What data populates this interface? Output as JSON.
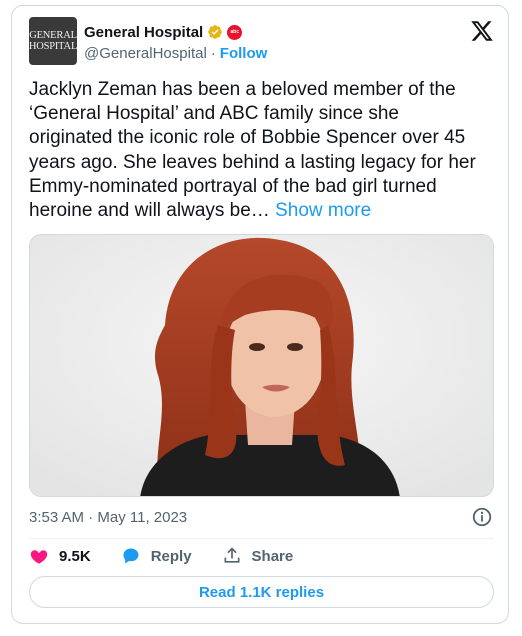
{
  "account": {
    "avatar_text_line1": "General",
    "avatar_text_line2": "Hospital",
    "display_name": "General Hospital",
    "handle": "@GeneralHospital",
    "separator": "·",
    "follow_label": "Follow",
    "verified_icon": "gold-verified-badge-icon",
    "affiliate_logo": "abc-logo"
  },
  "tweet": {
    "text": "Jacklyn Zeman has been a beloved member of the\n‘General Hospital’ and ABC family since she\noriginated the iconic role of Bobbie Spencer over 45\nyears ago. She leaves behind a lasting legacy for her\nEmmy-nominated portrayal of the bad girl turned\nheroine and will always be… ",
    "show_more_label": "Show more",
    "timestamp": "3:53 AM · May 11, 2023"
  },
  "actions": {
    "like_count": "9.5K",
    "reply_label": "Reply",
    "share_label": "Share"
  },
  "read_replies_label": "Read 1.1K replies",
  "colors": {
    "accent": "#1d9bf0",
    "like": "#f91880",
    "verified": "#e2b719",
    "secondary_text": "#536471",
    "border": "#cfd9de"
  }
}
